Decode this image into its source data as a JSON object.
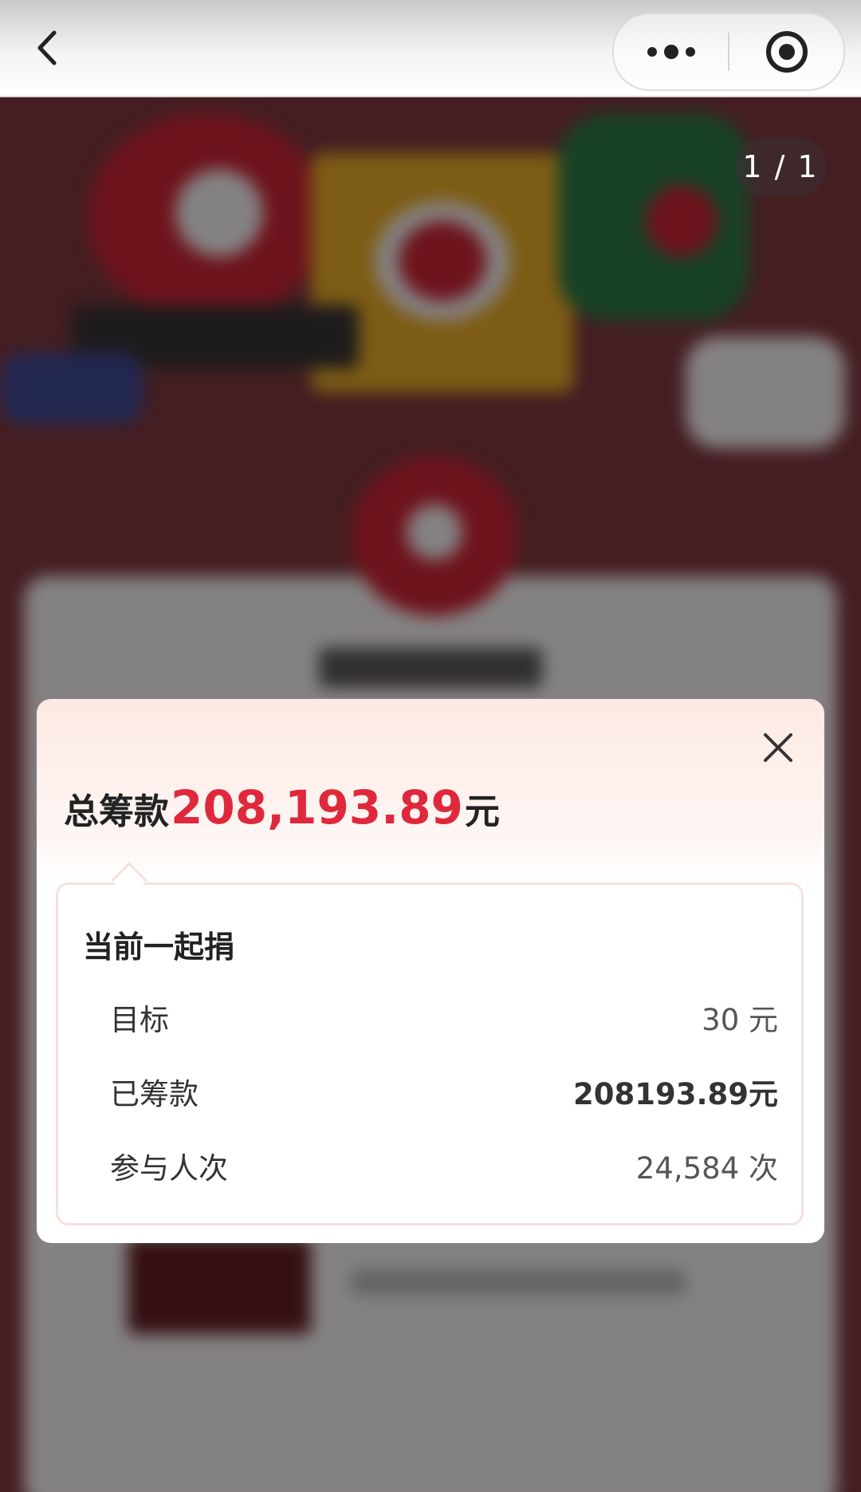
{
  "page_counter": "1 / 1",
  "modal": {
    "total_label": "总筹款",
    "total_amount": "208,193.89",
    "total_unit": "元",
    "section_title": "当前一起捐",
    "rows": [
      {
        "label": "目标",
        "value": "30 元"
      },
      {
        "label": "已筹款",
        "value": "208193.89元"
      },
      {
        "label": "参与人次",
        "value": "24,584 次"
      }
    ]
  },
  "icons": {
    "back": "chevron-left-icon",
    "more": "more-dots-icon",
    "close_miniprogram": "target-circle-icon",
    "close_modal": "close-icon"
  },
  "colors": {
    "accent": "#e0283c",
    "modal_top": "#fde9e3"
  }
}
